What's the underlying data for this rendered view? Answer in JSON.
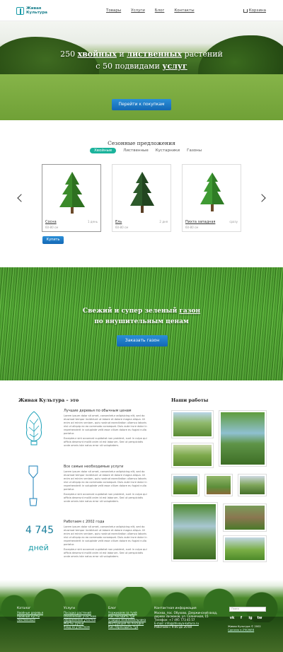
{
  "header": {
    "logo": "Живая Культура",
    "nav": [
      "Товары",
      "Услуги",
      "Блог",
      "Контакты"
    ],
    "cart": "Корзина"
  },
  "hero": {
    "line1_a": "250 ",
    "line1_b": "хвойных",
    "line1_c": " и ",
    "line1_d": "лиственных",
    "line1_e": " растений",
    "line2_a": "с 50 подвидами ",
    "line2_b": "услуг",
    "button": "Перейти к покупкам"
  },
  "seasonal": {
    "title": "Сезонные предложения",
    "tabs": [
      "Хвойные",
      "Лиственные",
      "Кустарники",
      "Газоны"
    ],
    "cards": [
      {
        "name": "Сосна",
        "size": "60-80 см",
        "price": "1 день"
      },
      {
        "name": "Ель",
        "size": "60-80 см",
        "price": "2 дня"
      },
      {
        "name": "Пихта западная",
        "size": "60-80 см",
        "price": "сразу"
      }
    ],
    "buy": "Купить"
  },
  "lawn": {
    "line1_a": "Свежий и супер зеленый ",
    "line1_b": "газон",
    "line2": "по внушительным ценам",
    "button": "Заказать газон"
  },
  "about": {
    "title": "Живая Культура – это",
    "features": [
      {
        "title": "Лучшие деревья по обычным ценам",
        "p1": "Lorem ipsum dolor sit amet, consectetur adipisicing elit, sed do eiusmod tempor incididunt ut labore et dolore magna aliqua. Ut enim ad minim veniam, quis nostrud exercitation ullamco laboris nisi ut aliquip ex ea commodo consequat. Duis aute irure dolor in reprehenderit in voluptate velit esse cillum dolore eu fugiat nulla pariatur.",
        "p2": "Excepteur sint occaecat cupidatat non proident, sunt in culpa qui officia deserunt mollit anim id est laborum. Sed ut perspiciatis unde omnis iste natus error sit voluptatem."
      },
      {
        "title": "Все самые необходимые услуги",
        "p1": "Lorem ipsum dolor sit amet, consectetur adipisicing elit, sed do eiusmod tempor incididunt ut labore et dolore magna aliqua. Ut enim ad minim veniam, quis nostrud exercitation ullamco laboris nisi ut aliquip ex ea commodo consequat. Duis aute irure dolor in reprehenderit in voluptate velit esse cillum dolore eu fugiat nulla pariatur.",
        "p2": "Excepteur sint occaecat cupidatat non proident, sunt in culpa qui officia deserunt mollit anim id est laborum. Sed ut perspiciatis unde omnis iste natus error sit voluptatem."
      },
      {
        "title": "Работаем с 2002 года",
        "p1": "Lorem ipsum dolor sit amet, consectetur adipisicing elit, sed do eiusmod tempor incididunt ut labore et dolore magna aliqua. Ut enim ad minim veniam, quis nostrud exercitation ullamco laboris nisi ut aliquip ex ea commodo consequat. Duis aute irure dolor in reprehenderit in voluptate velit esse cillum dolore eu fugiat nulla pariatur.",
        "p2": "Excepteur sint occaecat cupidatat non proident, sunt in culpa qui officia deserunt mollit anim id est laborum. Sed ut perspiciatis unde omnis iste natus error sit voluptatem."
      }
    ],
    "days_number": "4 745",
    "days_label": "дней"
  },
  "works": {
    "title": "Наши работы"
  },
  "footer": {
    "col1": {
      "title": "Каталог",
      "links": [
        "Хвойные деревья",
        "Хвойные кусты",
        "Лиственные"
      ]
    },
    "col2": {
      "title": "Услуги",
      "links": [
        "Посадка растений",
        "Озеленение участков",
        "Оформление участка",
        "Мосты, ручьи",
        "Уход за участком"
      ]
    },
    "col3": {
      "title": "Блог",
      "links": [
        "Ухаживаем за туей",
        "Как посадить туи",
        "О видах можжевельника",
        "Инструкция по посадке",
        "Как пересадить туи"
      ]
    },
    "col4": {
      "title": "Контактная информация",
      "lines": [
        "Москва, пос. Обухово, Дзержинский вход,",
        "дерево Засмоков, ул. Солнечная, 15",
        "Телефон: +7 495 773 45 57",
        "E-mail: info@zhivaya-kultura.ru",
        "Работаем с 9:00 до 20:00"
      ]
    },
    "search_placeholder": "Поиск",
    "social": [
      "vk",
      "f",
      "ig",
      "tw"
    ],
    "copyright": "Живая Культура © 2002",
    "made_by": "Сделано в ZYK/WEB"
  }
}
